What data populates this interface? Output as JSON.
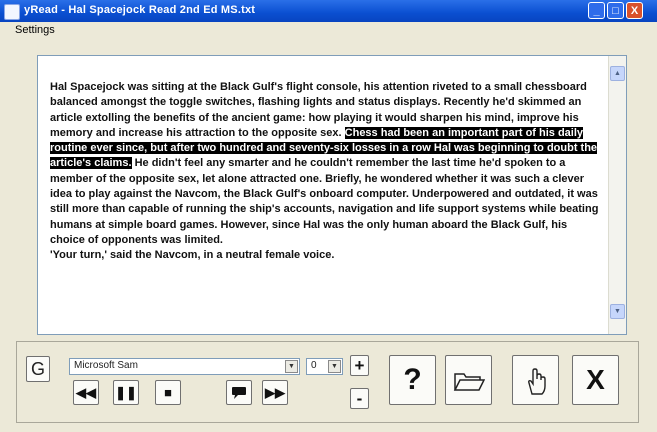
{
  "window": {
    "title": "yRead - Hal Spacejock Read 2nd Ed MS.txt",
    "min_label": "_",
    "max_label": "□",
    "close_label": "X"
  },
  "menu": {
    "items": [
      "Settings"
    ]
  },
  "document": {
    "text_before": "Hal Spacejock was sitting at the Black Gulf's flight console, his attention riveted to a small chessboard balanced amongst the toggle switches, flashing lights and status displays. Recently he'd skimmed an article extolling the benefits of the ancient game: how playing it would sharpen his mind, improve his memory and increase his attraction to the opposite sex.",
    "highlighted": "Chess had been an important part of his daily routine ever since, but after two hundred and seventy-six losses in a row Hal was beginning to doubt the article's claims.",
    "text_after": " He didn't feel any smarter and he couldn't remember the last time he'd spoken to a member of the opposite sex, let alone attracted one. Briefly, he wondered whether it was such a clever idea to play against the Navcom, the Black Gulf's onboard computer. Underpowered and outdated, it was still more than capable of running the ship's accounts, navigation and life support systems while beating humans at simple board games. However, since Hal was the only human aboard the Black Gulf, his choice of opponents was limited.",
    "paragraph2": "'Your turn,' said the Navcom, in a neutral female voice."
  },
  "controls": {
    "g_label": "G",
    "font_name": "Microsoft Sam",
    "size_value": "0",
    "plus_label": "+",
    "minus_label": "-",
    "help_label": "?",
    "exit_label": "X",
    "dropdown_arrow": "▼",
    "scroll_up": "▲",
    "scroll_down": "▼",
    "rewind_label": "◀◀",
    "pause_label": "❚❚",
    "stop_label": "■",
    "forward_label": "▶▶"
  },
  "icons": {
    "rewind": "rewind-icon",
    "pause": "pause-icon",
    "stop": "stop-icon",
    "speak": "speech-bubble-icon",
    "forward": "fast-forward-icon",
    "open": "folder-icon",
    "settings": "hand-pointer-icon"
  },
  "colors": {
    "highlight_bg": "#000000",
    "titlebar": "#0a4fd1"
  }
}
